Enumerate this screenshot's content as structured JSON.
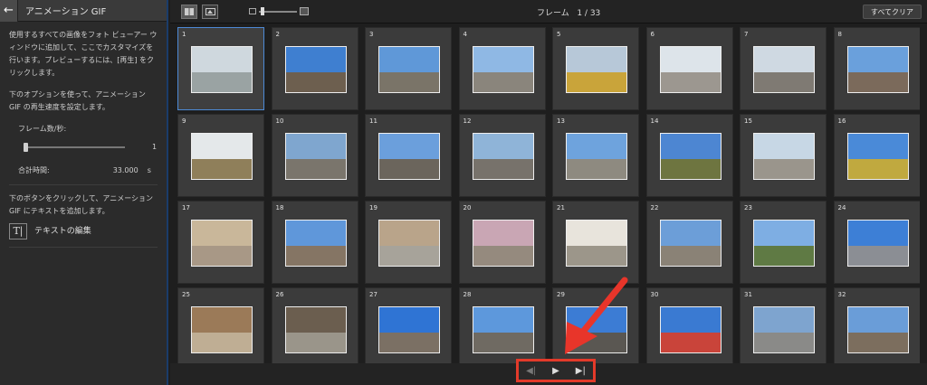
{
  "sidebar": {
    "title": "アニメーション GIF",
    "desc1": "使用するすべての画像をフォト ビューアー ウィンドウに追加して、ここでカスタマイズを行います。プレビューするには、[再生] をクリックします。",
    "desc2": "下のオプションを使って、アニメーション GIF の再生速度を設定します。",
    "fps_label": "フレーム数/秒:",
    "fps_value": "1",
    "total_label": "合計時間:",
    "total_value": "33.000",
    "total_unit": "s",
    "desc3": "下のボタンをクリックして、アニメーション GIF にテキストを追加します。",
    "edit_text_label": "テキストの編集"
  },
  "topbar": {
    "frame_label": "フレーム",
    "frame_current": "1",
    "frame_total": "33",
    "clear_all_label": "すべてクリア"
  },
  "frames": [
    {
      "n": "1",
      "sky": "#cfd8de",
      "ground": "#9aa3a3"
    },
    {
      "n": "2",
      "sky": "#3f7fd0",
      "ground": "#6d5f4f"
    },
    {
      "n": "3",
      "sky": "#5f98d8",
      "ground": "#7a7468"
    },
    {
      "n": "4",
      "sky": "#8fb8e4",
      "ground": "#8a857c"
    },
    {
      "n": "5",
      "sky": "#b7c8d8",
      "ground": "#c9a43a"
    },
    {
      "n": "6",
      "sky": "#dde4ea",
      "ground": "#9c9790"
    },
    {
      "n": "7",
      "sky": "#cfd9e2",
      "ground": "#7f7a73"
    },
    {
      "n": "8",
      "sky": "#6aa0dc",
      "ground": "#7b6a5b"
    },
    {
      "n": "9",
      "sky": "#e4e8ea",
      "ground": "#8f7f5a"
    },
    {
      "n": "10",
      "sky": "#7fa6cf",
      "ground": "#7a756c"
    },
    {
      "n": "11",
      "sky": "#6b9fdc",
      "ground": "#6b655c"
    },
    {
      "n": "12",
      "sky": "#8fb4d8",
      "ground": "#77726b"
    },
    {
      "n": "13",
      "sky": "#6ea3dd",
      "ground": "#8e8a80"
    },
    {
      "n": "14",
      "sky": "#4d86d2",
      "ground": "#6e7540"
    },
    {
      "n": "15",
      "sky": "#c7d7e5",
      "ground": "#9a958c"
    },
    {
      "n": "16",
      "sky": "#4a8ad8",
      "ground": "#c0a93f"
    },
    {
      "n": "17",
      "sky": "#c9b79a",
      "ground": "#a89886"
    },
    {
      "n": "18",
      "sky": "#5f97da",
      "ground": "#857564"
    },
    {
      "n": "19",
      "sky": "#b9a48a",
      "ground": "#a7a39a"
    },
    {
      "n": "20",
      "sky": "#c9a6b4",
      "ground": "#958a7e"
    },
    {
      "n": "21",
      "sky": "#e8e4dc",
      "ground": "#9c968a"
    },
    {
      "n": "22",
      "sky": "#6c9ed8",
      "ground": "#8a8276"
    },
    {
      "n": "23",
      "sky": "#7eaee3",
      "ground": "#5f7a44"
    },
    {
      "n": "24",
      "sky": "#3d7fd6",
      "ground": "#8b8e94"
    },
    {
      "n": "25",
      "sky": "#9b7a58",
      "ground": "#bfae94"
    },
    {
      "n": "26",
      "sky": "#6b5e4f",
      "ground": "#9a958a"
    },
    {
      "n": "27",
      "sky": "#2f74d4",
      "ground": "#7b7064"
    },
    {
      "n": "28",
      "sky": "#5d98dc",
      "ground": "#6f6a62"
    },
    {
      "n": "29",
      "sky": "#3c7cd4",
      "ground": "#5a5752"
    },
    {
      "n": "30",
      "sky": "#3a7ad2",
      "ground": "#c9443a"
    },
    {
      "n": "31",
      "sky": "#7ea4cf",
      "ground": "#8a8a88"
    },
    {
      "n": "32",
      "sky": "#6a9dd8",
      "ground": "#7c6e5e"
    }
  ],
  "controls": {
    "prev_icon": "skip-back-icon",
    "play_icon": "play-icon",
    "next_icon": "skip-forward-icon"
  },
  "colors": {
    "selection": "#4d8ad6",
    "highlight": "#e33a2a"
  }
}
